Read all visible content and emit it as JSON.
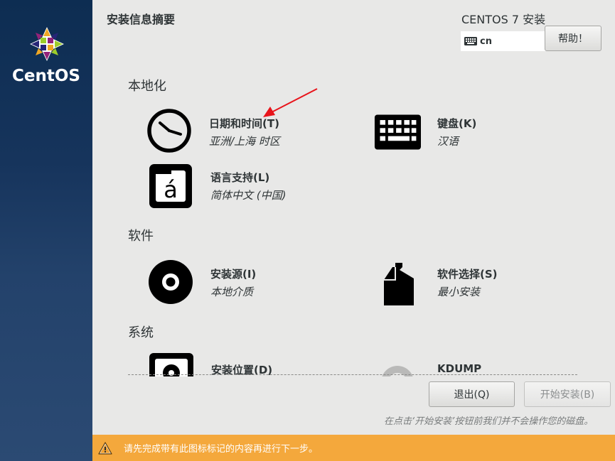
{
  "sidebar": {
    "brand": "CentOS"
  },
  "header": {
    "page_title": "安装信息摘要",
    "product_title": "CENTOS 7 安装",
    "keyboard_layout": "cn",
    "help_label": "帮助！"
  },
  "sections": {
    "localization": "本地化",
    "software": "软件",
    "system": "系统"
  },
  "spokes": {
    "datetime": {
      "title": "日期和时间(T)",
      "status": "亚洲/上海 时区"
    },
    "keyboard": {
      "title": "键盘(K)",
      "status": "汉语"
    },
    "language": {
      "title": "语言支持(L)",
      "status": "简体中文 (中国)"
    },
    "source": {
      "title": "安装源(I)",
      "status": "本地介质"
    },
    "software_selection": {
      "title": "软件选择(S)",
      "status": "最小安装"
    },
    "destination": {
      "title": "安装位置(D)"
    },
    "kdump": {
      "title": "KDUMP"
    }
  },
  "footer": {
    "quit_label": "退出(Q)",
    "begin_label": "开始安装(B)",
    "hint": "在点击‘开始安装’按钮前我们并不会操作您的磁盘。",
    "warning": "请先完成带有此图标标记的内容再进行下一步。"
  },
  "colors": {
    "sidebar": "#16345c",
    "warning_bar": "#f4a83c",
    "annotation_arrow": "#e8141b"
  },
  "icons": {
    "logo": "centos-logo-icon",
    "keyboard_indicator": "keyboard-icon",
    "datetime": "clock-icon",
    "keyboard": "keyboard-icon",
    "language": "language-icon",
    "source": "disc-icon",
    "software_selection": "package-icon",
    "destination": "harddrive-icon",
    "kdump": "kdump-icon",
    "warning": "warning-icon"
  }
}
